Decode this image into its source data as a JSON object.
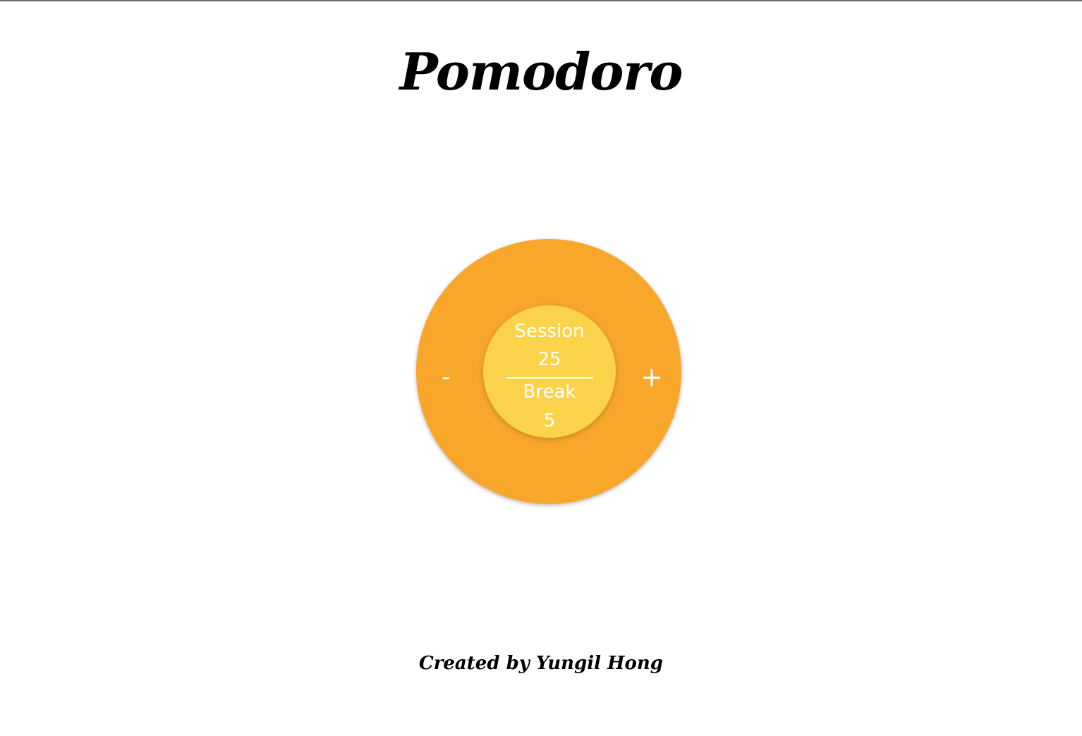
{
  "header": {
    "title": "Pomodoro"
  },
  "timer": {
    "session_label": "Session",
    "session_value": "25",
    "break_label": "Break",
    "break_value": "5",
    "decrease_label": "-",
    "increase_label": "+"
  },
  "footer": {
    "credit": "Created by Yungil Hong"
  },
  "colors": {
    "outer_circle": "#f9a72b",
    "inner_circle": "#fbd34a",
    "text_light": "#ffffff",
    "text_dark": "#000000"
  }
}
